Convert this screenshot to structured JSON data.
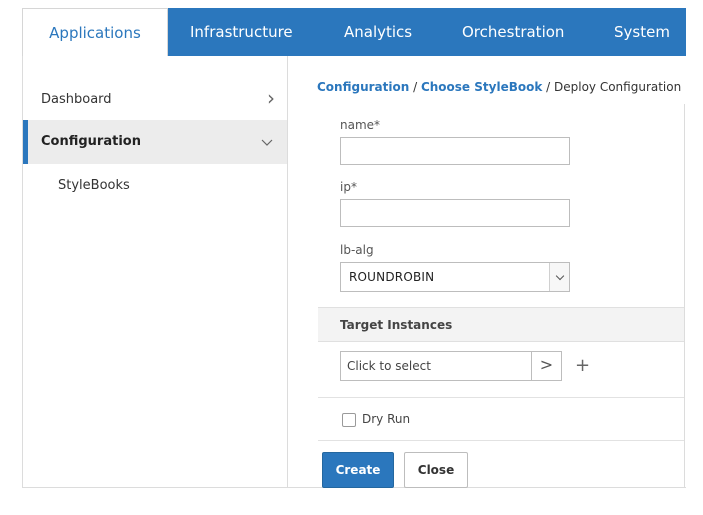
{
  "topnav": {
    "tabs": [
      {
        "label": "Applications",
        "active": true
      },
      {
        "label": "Infrastructure",
        "active": false
      },
      {
        "label": "Analytics",
        "active": false
      },
      {
        "label": "Orchestration",
        "active": false
      },
      {
        "label": "System",
        "active": false
      }
    ]
  },
  "sidebar": {
    "items": [
      {
        "label": "Dashboard",
        "icon": "chevron-right-icon",
        "expanded": false
      },
      {
        "label": "Configuration",
        "icon": "chevron-down-icon",
        "expanded": true,
        "active": true
      }
    ],
    "subitems": [
      {
        "label": "StyleBooks"
      }
    ]
  },
  "breadcrumb": {
    "link1": "Configuration",
    "sep1": " / ",
    "link2": "Choose StyleBook",
    "sep2": " / ",
    "current": "Deploy Configuration"
  },
  "form": {
    "name_label": "name*",
    "name_value": "",
    "ip_label": "ip*",
    "ip_value": "",
    "lbalg_label": "lb-alg",
    "lbalg_value": "ROUNDROBIN",
    "target_title": "Target Instances",
    "picker_placeholder": "Click to select",
    "picker_arrow": ">",
    "add_symbol": "+",
    "dryrun_label": "Dry Run",
    "dryrun_checked": false,
    "create_label": "Create",
    "close_label": "Close"
  },
  "colors": {
    "accent": "#2b77bd",
    "sidebar_active_bg": "#ececec"
  }
}
